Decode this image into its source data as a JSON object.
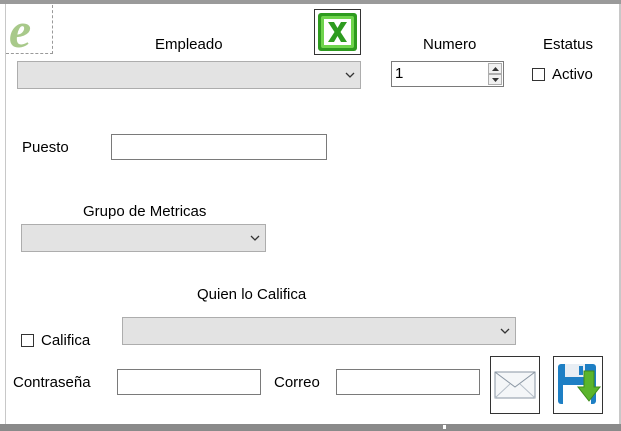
{
  "form": {
    "empleado_label": "Empleado",
    "numero_label": "Numero",
    "numero_value": "1",
    "estatus_label": "Estatus",
    "activo_label": "Activo",
    "puesto_label": "Puesto",
    "puesto_value": "",
    "grupo_metricas_label": "Grupo de Metricas",
    "quien_califica_label": "Quien lo Califica",
    "califica_label": "Califica",
    "contrasena_label": "Contraseña",
    "contrasena_value": "",
    "correo_label": "Correo",
    "correo_value": ""
  },
  "icons": {
    "logo": "e-logo-icon",
    "excel": "excel-icon",
    "email": "envelope-icon",
    "save": "save-download-icon"
  },
  "colors": {
    "combo_bg": "#e3e3e3",
    "excel_green": "#2e9b1f",
    "save_blue": "#1e7fc4",
    "save_arrow_green": "#5ab52c",
    "logo_green": "#a8c98a"
  }
}
